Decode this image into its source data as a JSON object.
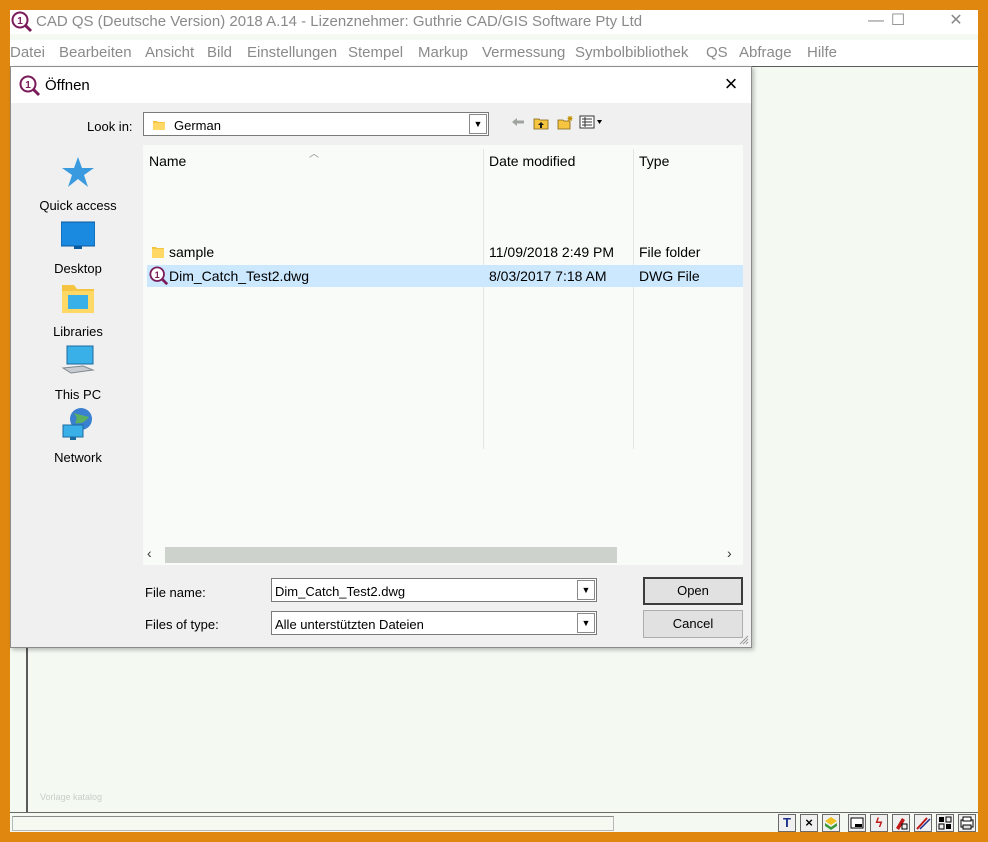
{
  "app": {
    "title": "CAD QS (Deutsche Version) 2018 A.14 - Lizenznehmer: Guthrie CAD/GIS Software Pty Ltd",
    "menu": [
      "Datei",
      "Bearbeiten",
      "Ansicht",
      "Bild",
      "Einstellungen",
      "Stempel",
      "Markup",
      "Vermessung",
      "Symbolbibliothek",
      "QS",
      "Abfrage",
      "Hilfe"
    ],
    "watermark": "Vorlage katalog",
    "accent_color": "#e0870f"
  },
  "dialog": {
    "title": "Öffnen",
    "look_in_label": "Look in:",
    "look_in_value": "German",
    "places": [
      {
        "label": "Quick access",
        "icon": "star-icon"
      },
      {
        "label": "Desktop",
        "icon": "desktop-icon"
      },
      {
        "label": "Libraries",
        "icon": "libraries-icon"
      },
      {
        "label": "This PC",
        "icon": "computer-icon"
      },
      {
        "label": "Network",
        "icon": "network-icon"
      }
    ],
    "columns": {
      "name": "Name",
      "date": "Date modified",
      "type": "Type"
    },
    "files": [
      {
        "name": "sample",
        "date": "11/09/2018 2:49 PM",
        "type": "File folder",
        "icon": "folder-icon"
      },
      {
        "name": "Dim_Catch_Test2.dwg",
        "date": "8/03/2017 7:18 AM",
        "type": "DWG File",
        "icon": "dwg-file-icon"
      }
    ],
    "file_name_label": "File name:",
    "file_name_value": "Dim_Catch_Test2.dwg",
    "file_type_label": "Files of type:",
    "file_type_value": "Alle unterstützten Dateien",
    "open_label": "Open",
    "cancel_label": "Cancel"
  },
  "status_icons": [
    "T",
    "×"
  ]
}
